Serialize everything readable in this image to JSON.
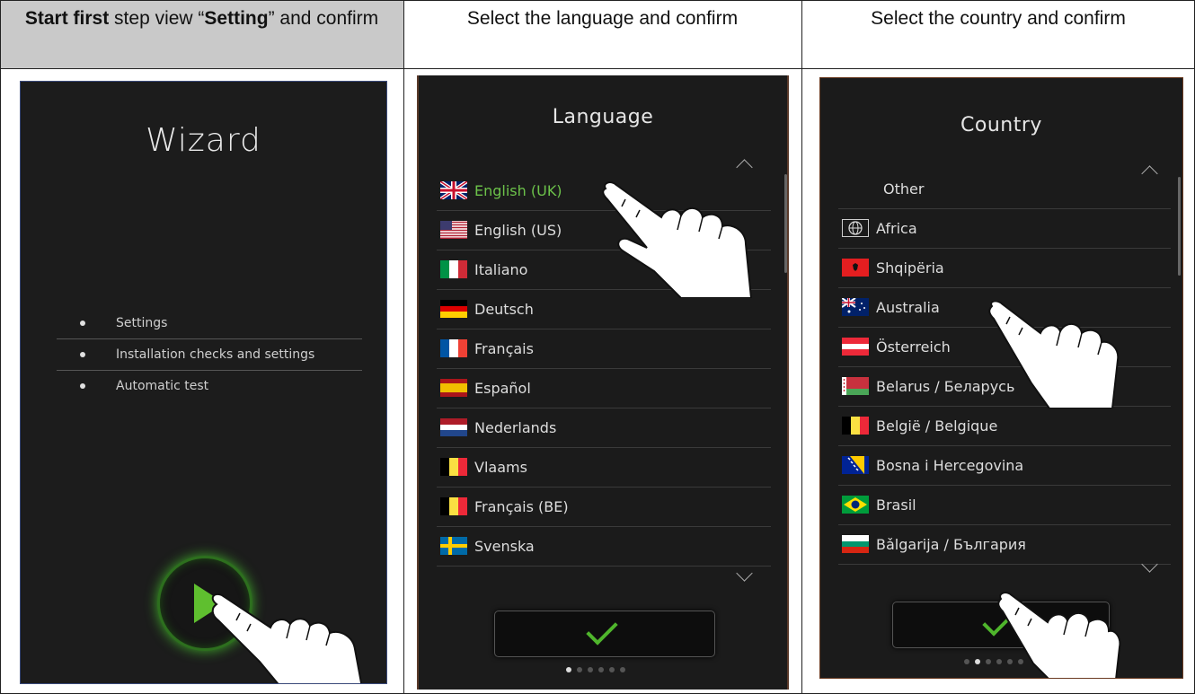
{
  "headers": {
    "col1_bold1": "Start first",
    "col1_mid": " step view “",
    "col1_bold2": "Setting",
    "col1_end": "” and confirm",
    "col2": "Select the language and  confirm",
    "col3": "Select the country and confirm"
  },
  "wizard": {
    "title": "Wizard",
    "items": [
      "Settings",
      "Installation checks and settings",
      "Automatic test"
    ],
    "play_color": "#5fbf2f"
  },
  "language": {
    "title": "Language",
    "items": [
      "English (UK)",
      "English (US)",
      "Italiano",
      "Deutsch",
      "Français",
      "Español",
      "Nederlands",
      "Vlaams",
      "Français (BE)",
      "Svenska"
    ],
    "selected": "English (UK)",
    "selected_color": "#6cc24a",
    "page_indicator": {
      "count": 6,
      "active": 1
    }
  },
  "country": {
    "title": "Country",
    "items": [
      "Other",
      "Africa",
      "Shqipëria",
      "Australia",
      "Österreich",
      "Belarus / Беларусь",
      "België / Belgique",
      "Bosna i Hercegovina",
      "Brasil",
      "Bǎlgarija / България"
    ],
    "page_indicator": {
      "count": 6,
      "active": 2
    }
  },
  "icons": {
    "up": "chevron-up-icon",
    "down": "chevron-down-icon",
    "confirm": "checkmark-icon",
    "play": "play-icon",
    "globe": "globe-icon",
    "hand": "pointing-hand-icon"
  }
}
